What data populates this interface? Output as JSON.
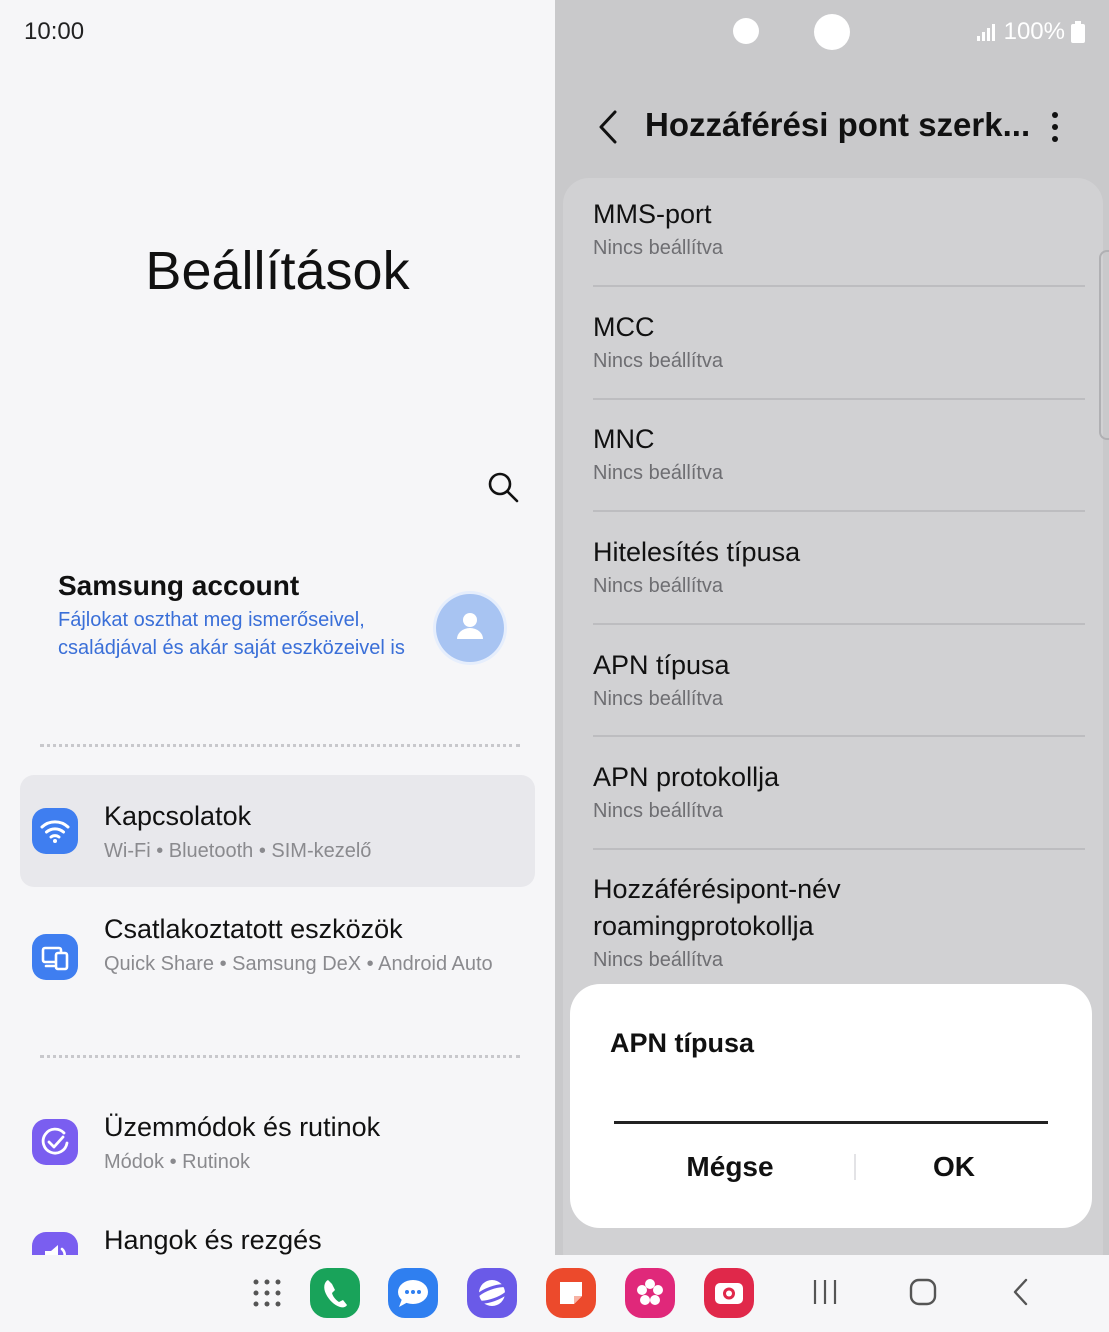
{
  "status": {
    "time": "10:00",
    "battery": "100%"
  },
  "left": {
    "title": "Beállítások",
    "account": {
      "title": "Samsung account",
      "subtitle": "Fájlokat oszthat meg ismerőseivel, családjával és akár saját eszközeivel is"
    },
    "items": [
      {
        "title": "Kapcsolatok",
        "subtitle": "Wi-Fi  •  Bluetooth  •  SIM-kezelő",
        "color": "#3f7ef0",
        "icon": "wifi-icon"
      },
      {
        "title": "Csatlakoztatott eszközök",
        "subtitle": "Quick Share  •  Samsung DeX  •  Android Auto",
        "color": "#3f7ef0",
        "icon": "devices-icon"
      },
      {
        "title": "Üzemmódok és rutinok",
        "subtitle": "Módok  •  Rutinok",
        "color": "#7a5ef0",
        "icon": "check-circle-icon"
      },
      {
        "title": "Hangok és rezgés",
        "subtitle": "",
        "color": "#7a5ef0",
        "icon": "speaker-icon"
      }
    ]
  },
  "right": {
    "title": "Hozzáférési pont szerk...",
    "items": [
      {
        "title": "MMS-port",
        "value": "Nincs beállítva"
      },
      {
        "title": "MCC",
        "value": "Nincs beállítva"
      },
      {
        "title": "MNC",
        "value": "Nincs beállítva"
      },
      {
        "title": "Hitelesítés típusa",
        "value": "Nincs beállítva"
      },
      {
        "title": "APN típusa",
        "value": "Nincs beállítva"
      },
      {
        "title": "APN protokollja",
        "value": "Nincs beállítva"
      },
      {
        "title": "Hozzáférésipont-név roamingprotokollja",
        "value": "Nincs beállítva"
      }
    ]
  },
  "dialog": {
    "title": "APN típusa",
    "input_value": "",
    "cancel_label": "Mégse",
    "ok_label": "OK"
  },
  "taskbar": {
    "apps": [
      {
        "name": "phone-app",
        "color": "#19a35a"
      },
      {
        "name": "messages-app",
        "color": "#2f7ff0"
      },
      {
        "name": "internet-app",
        "color": "#6a5ae8"
      },
      {
        "name": "notes-app",
        "color": "#ec4a2c"
      },
      {
        "name": "gallery-app",
        "color": "#e0287a"
      },
      {
        "name": "camera-app",
        "color": "#e0284a"
      }
    ]
  }
}
